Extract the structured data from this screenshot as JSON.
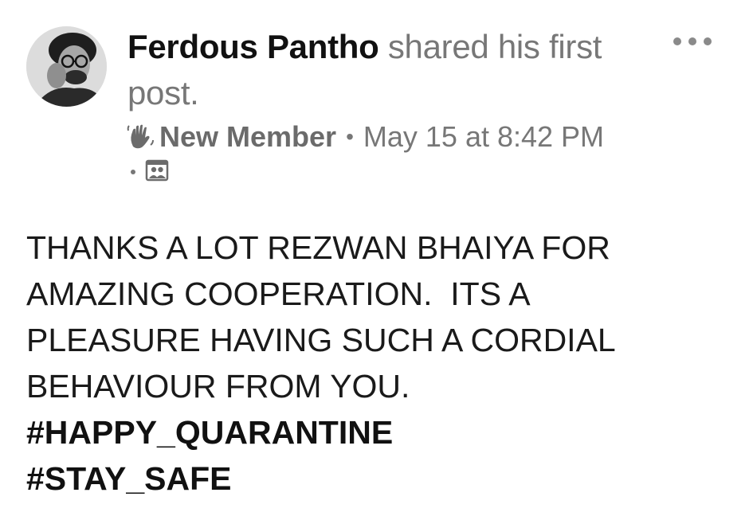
{
  "post": {
    "author": "Ferdous Pantho",
    "action_text": " shared his first post.",
    "badge": "New Member",
    "separator": "•",
    "timestamp": "May 15 at 8:42 PM",
    "privacy_separator": "•",
    "body_lines": [
      "THANKS A LOT REZWAN BHAIYA FOR",
      "AMAZING COOPERATION.  ITS A",
      "PLEASURE HAVING SUCH A CORDIAL",
      "BEHAVIOUR FROM YOU."
    ],
    "hashtags": [
      "#HAPPY_QUARANTINE",
      "#STAY_SAFE"
    ]
  },
  "icons": {
    "badge_icon": "wave-hand-icon",
    "privacy_icon": "group-members-icon",
    "more_icon": "more-options-icon"
  },
  "colors": {
    "author": "#111111",
    "muted": "#777777",
    "body": "#1a1a1a"
  }
}
